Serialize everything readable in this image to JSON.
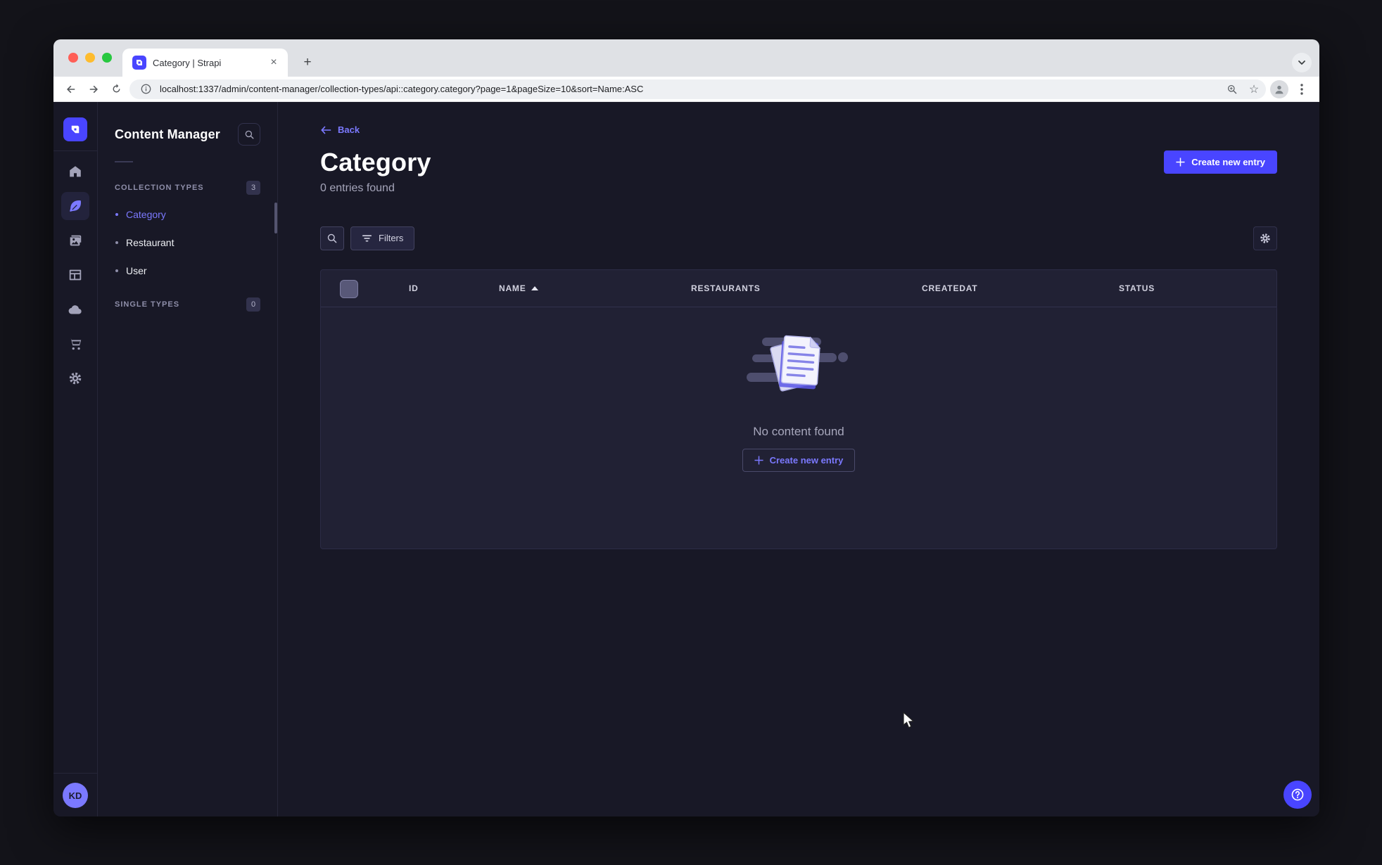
{
  "browser": {
    "tab_title": "Category | Strapi",
    "url": "localhost:1337/admin/content-manager/collection-types/api::category.category?page=1&pageSize=10&sort=Name:ASC",
    "new_tab_label": "+",
    "close_tab_label": "×"
  },
  "subnav": {
    "title": "Content Manager",
    "sections": [
      {
        "label": "COLLECTION TYPES",
        "badge": "3",
        "items": [
          {
            "label": "Category",
            "active": true
          },
          {
            "label": "Restaurant",
            "active": false
          },
          {
            "label": "User",
            "active": false
          }
        ]
      },
      {
        "label": "SINGLE TYPES",
        "badge": "0",
        "items": []
      }
    ]
  },
  "header": {
    "back_label": "Back",
    "title": "Category",
    "subtitle": "0 entries found",
    "create_button_label": "Create new entry"
  },
  "filters": {
    "label": "Filters"
  },
  "table": {
    "columns": [
      "ID",
      "NAME",
      "RESTAURANTS",
      "CREATEDAT",
      "STATUS"
    ],
    "sorted_column": "NAME",
    "sort_direction": "ASC",
    "empty_message": "No content found",
    "empty_create_button_label": "Create new entry"
  },
  "user": {
    "initials": "KD"
  },
  "colors": {
    "primary": "#4945ff",
    "link": "#7b79ff",
    "app_background": "#181826",
    "surface": "#212134",
    "border": "#32324d"
  }
}
